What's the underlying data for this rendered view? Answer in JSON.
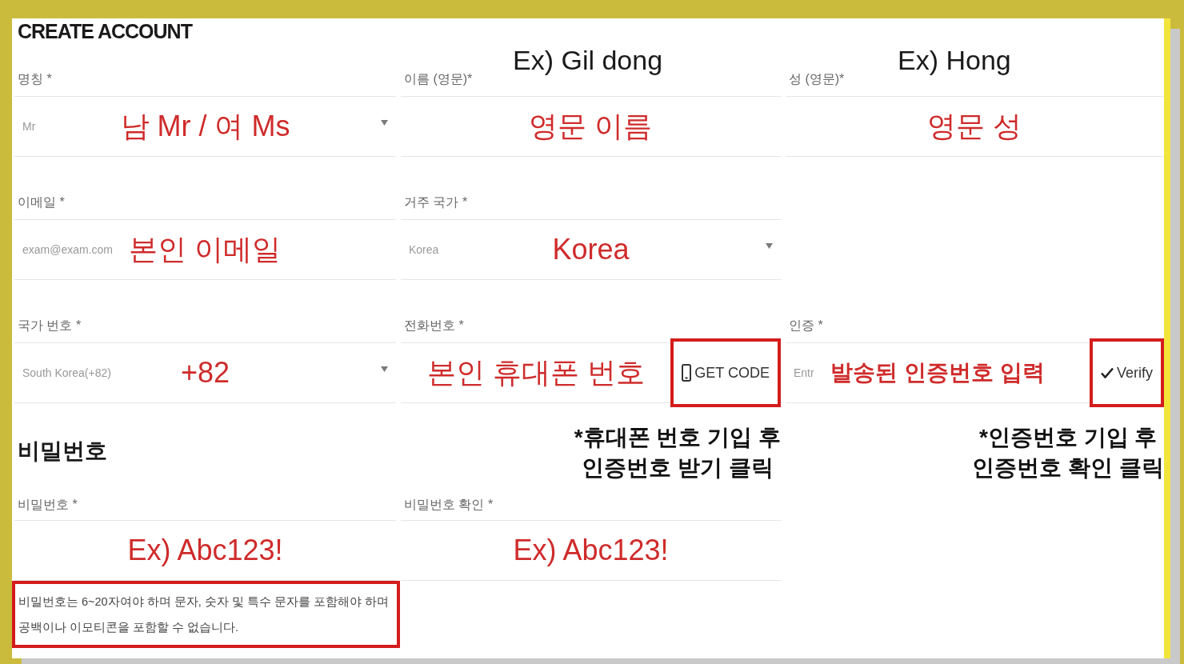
{
  "form": {
    "title": "CREATE ACCOUNT"
  },
  "rows": [
    {
      "fields": [
        {
          "kind": "select",
          "label": "명칭 *",
          "value": "Mr",
          "annotation": "남 Mr / 여 Ms",
          "annotation_bold": false
        },
        {
          "kind": "text",
          "label": "이름 (영문)*",
          "example": "Ex) Gil dong",
          "annotation": "영문 이름",
          "annotation_bold": false
        },
        {
          "kind": "text",
          "label": "성 (영문)*",
          "example": "Ex) Hong",
          "annotation": "영문 성",
          "annotation_bold": false
        }
      ]
    },
    {
      "fields": [
        {
          "kind": "text",
          "label": "이메일 *",
          "placeholder": "exam@exam.com",
          "annotation": "본인 이메일",
          "annotation_bold": false
        },
        {
          "kind": "select",
          "label": "거주 국가 *",
          "value": "Korea",
          "annotation": "Korea",
          "annotation_bold": false
        }
      ]
    },
    {
      "fields": [
        {
          "kind": "select",
          "label": "국가 번호 *",
          "value": "South Korea(+82)",
          "annotation": "+82",
          "annotation_bold": false
        },
        {
          "kind": "text",
          "label": "전화번호 *",
          "annotation": "본인 휴대폰 번호",
          "annotation_bold": false,
          "button": {
            "kind": "request",
            "label": "GET CODE",
            "highlighted": true
          },
          "note": "*휴대폰 번호 기입 후\n인증번호 받기 클릭"
        },
        {
          "kind": "text",
          "label": "인증 *",
          "placeholder": "Entr",
          "annotation": "발송된 인증번호 입력",
          "annotation_bold": true,
          "button": {
            "kind": "verify",
            "label": "Verify",
            "highlighted": true
          },
          "note": "*인증번호 기입 후\n인증번호 확인 클릭"
        }
      ]
    },
    {
      "heading": "비밀번호",
      "fields": [
        {
          "kind": "text",
          "label": "비밀번호 *",
          "annotation": "Ex) Abc123!",
          "annotation_bold": false
        },
        {
          "kind": "text",
          "label": "비밀번호 확인 *",
          "annotation": "Ex) Abc123!",
          "annotation_bold": false
        }
      ],
      "hint": {
        "text": "비밀번호는 6~20자여야 하며 문자, 숫자 및 특수 문자를 포함해야 하며 공백이나 이모티콘을 포함할 수 없습니다.",
        "highlighted": true
      }
    }
  ]
}
